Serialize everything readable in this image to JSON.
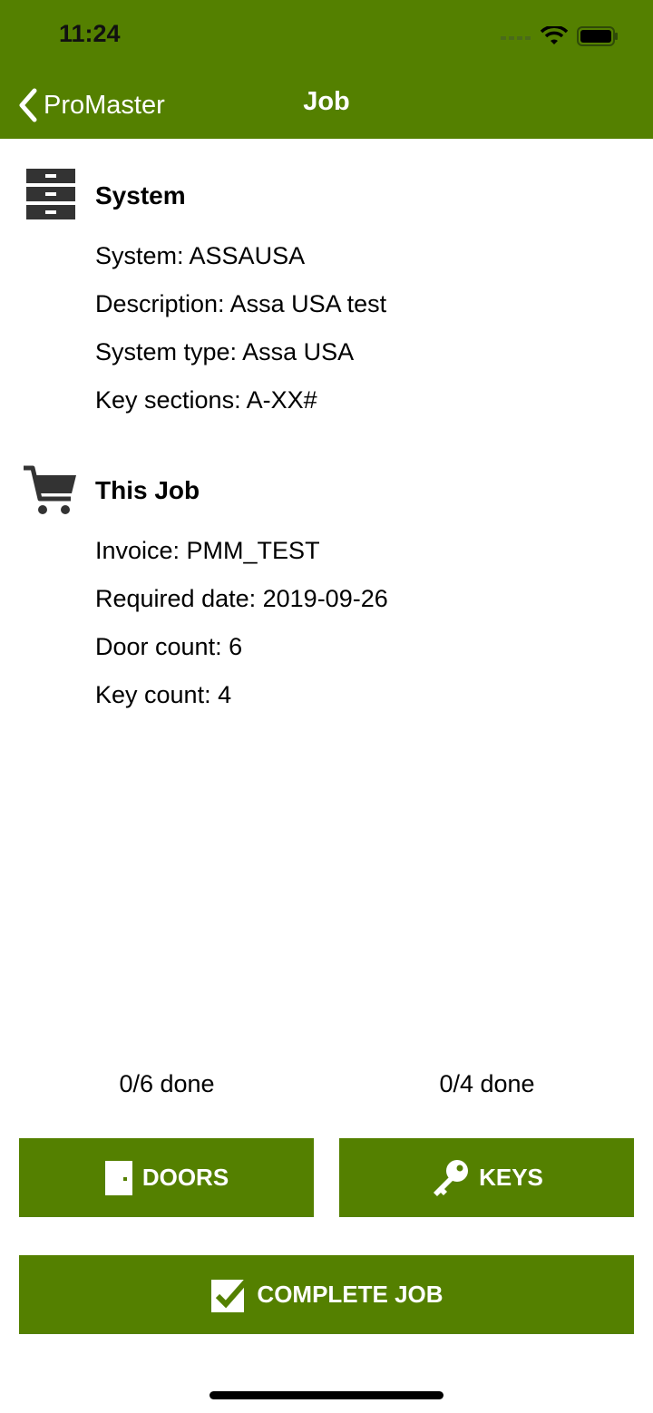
{
  "status_bar": {
    "time": "11:24"
  },
  "nav": {
    "back_label": "ProMaster",
    "title": "Job"
  },
  "system_section": {
    "heading": "System",
    "icon": "filing-cabinet-icon",
    "lines": [
      "System: ASSAUSA",
      "Description: Assa USA test",
      "System type: Assa USA",
      "Key sections: A-XX#"
    ]
  },
  "job_section": {
    "heading": "This Job",
    "icon": "shopping-cart-icon",
    "lines": [
      "Invoice: PMM_TEST",
      "Required date: 2019-09-26",
      "Door count: 6",
      "Key count: 4"
    ]
  },
  "progress": {
    "doors_done": "0/6 done",
    "keys_done": "0/4 done"
  },
  "buttons": {
    "doors": "DOORS",
    "keys": "KEYS",
    "complete": "COMPLETE JOB"
  },
  "colors": {
    "accent": "#548000"
  }
}
